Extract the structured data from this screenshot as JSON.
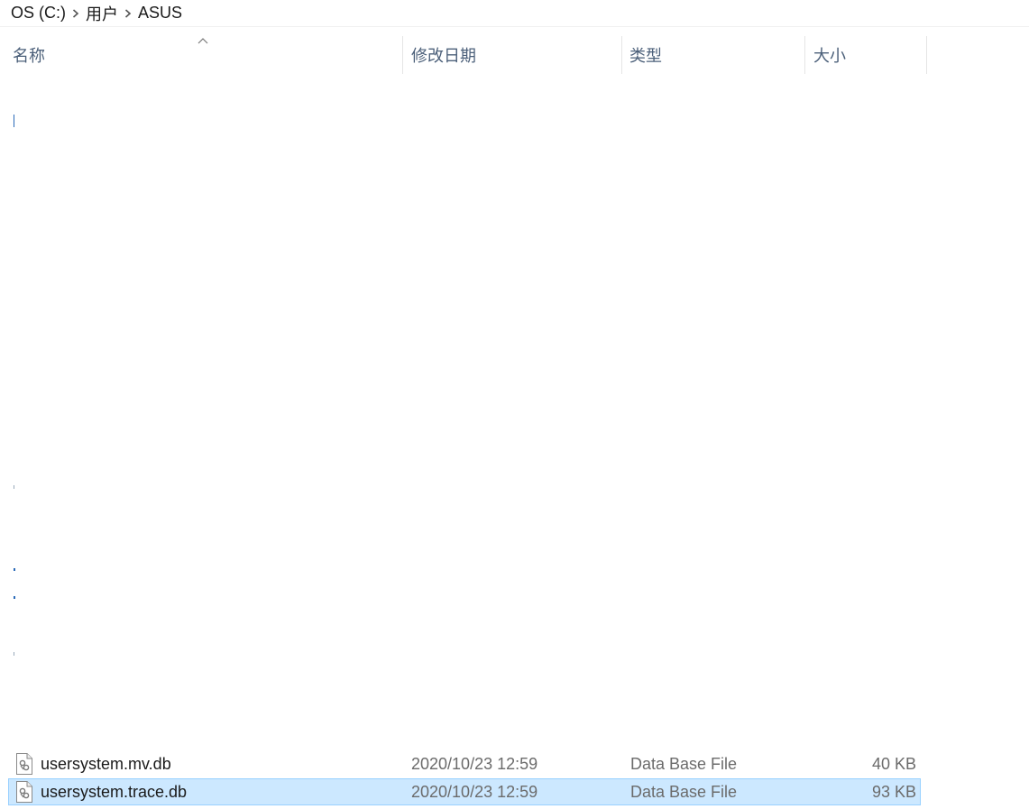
{
  "breadcrumb": {
    "items": [
      {
        "label": "OS (C:)"
      },
      {
        "label": "用户"
      },
      {
        "label": "ASUS"
      }
    ],
    "separator_icon": "chevron-right-icon"
  },
  "columns": {
    "name": "名称",
    "modified": "修改日期",
    "type": "类型",
    "size": "大小",
    "sort_icon": "sort-ascending-icon"
  },
  "files": [
    {
      "name": "usersystem.mv.db",
      "modified": "2020/10/23 12:59",
      "type": "Data Base File",
      "size": "40 KB",
      "icon": "database-file-icon",
      "selected": false
    },
    {
      "name": "usersystem.trace.db",
      "modified": "2020/10/23 12:59",
      "type": "Data Base File",
      "size": "93 KB",
      "icon": "database-file-icon",
      "selected": true
    }
  ],
  "colors": {
    "header_text": "#4c607a",
    "selection_bg": "#cce8ff",
    "selection_border": "#99d1ff"
  }
}
